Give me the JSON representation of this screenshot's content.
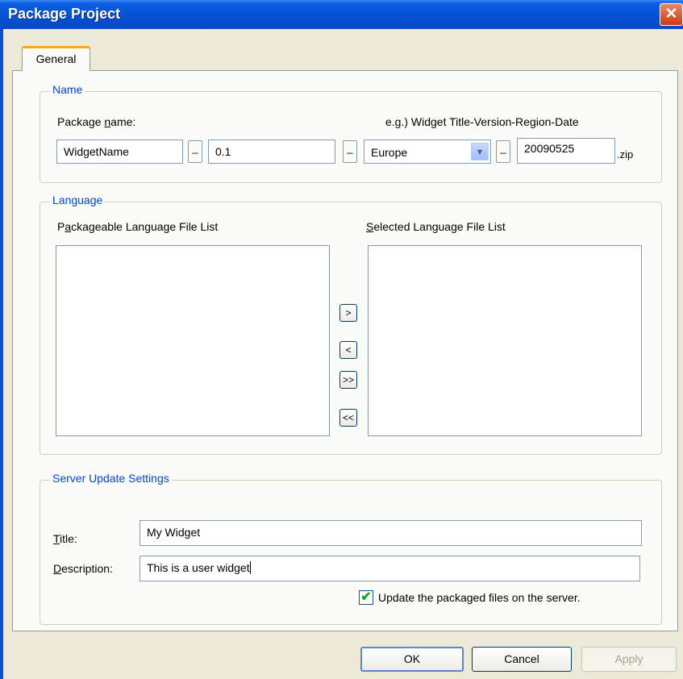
{
  "window": {
    "title": "Package Project",
    "close_glyph": "✕"
  },
  "tabs": [
    {
      "label": "General"
    }
  ],
  "name_group": {
    "title": "Name",
    "package_name_label": "Package name:",
    "example": "e.g.) Widget Title-Version-Region-Date",
    "widget_name": "WidgetName",
    "separator": "_",
    "version": "0.1",
    "region": "Europe",
    "date": "20090525",
    "extension": ".zip"
  },
  "language_group": {
    "title": "Language",
    "available_list_label": "Packageable Language File List",
    "selected_list_label": "Selected Language File List",
    "available_items": [],
    "selected_items": [],
    "buttons": {
      "add": ">",
      "remove": "<",
      "add_all": ">>",
      "remove_all": "<<"
    }
  },
  "server_group": {
    "title": "Server Update Settings",
    "title_label": "Title:",
    "title_value": "My Widget",
    "description_label": "Description:",
    "description_value": "This is a user widget",
    "update_checkbox_label": "Update the packaged files on the server.",
    "update_checked": true,
    "check_glyph": "✔"
  },
  "footer": {
    "ok": "OK",
    "cancel": "Cancel",
    "apply": "Apply"
  },
  "icons": {
    "dropdown": "chevron-down-icon",
    "close": "close-icon",
    "check": "check-icon"
  },
  "colors": {
    "titlebar": "#0551d4",
    "group_title": "#0046d5",
    "dialog_bg": "#ece9d8",
    "check": "#21a121"
  }
}
